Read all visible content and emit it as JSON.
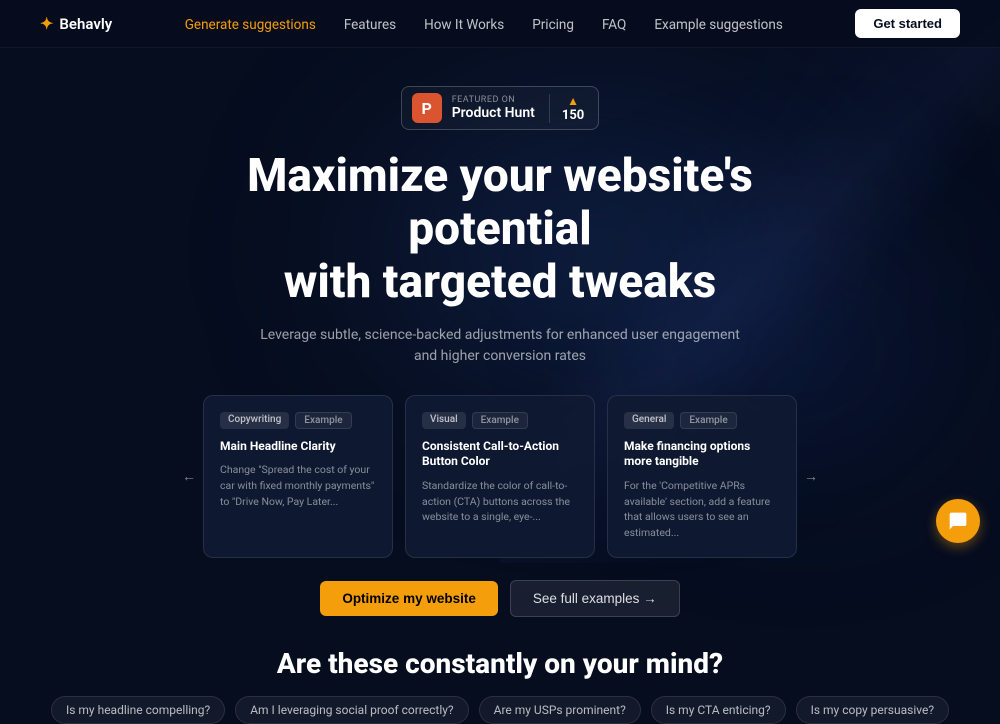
{
  "nav": {
    "logo_text": "Behavly",
    "logo_icon": "✦",
    "links": [
      {
        "label": "Generate suggestions",
        "active": true
      },
      {
        "label": "Features",
        "active": false
      },
      {
        "label": "How It Works",
        "active": false
      },
      {
        "label": "Pricing",
        "active": false
      },
      {
        "label": "FAQ",
        "active": false
      },
      {
        "label": "Example suggestions",
        "active": false
      }
    ],
    "cta_label": "Get started"
  },
  "product_hunt": {
    "featured_text": "FEATURED ON",
    "name": "Product Hunt",
    "count": "150",
    "logo_letter": "P"
  },
  "hero": {
    "title_line1": "Maximize your website's potential",
    "title_line2": "with targeted tweaks",
    "subtitle": "Leverage subtle, science-backed adjustments for enhanced user engagement and higher conversion rates"
  },
  "cards": [
    {
      "tag1": "Copywriting",
      "tag2": "Example",
      "title": "Main Headline Clarity",
      "body": "Change \"Spread the cost of your car with fixed monthly payments\" to \"Drive Now, Pay Later..."
    },
    {
      "tag1": "Visual",
      "tag2": "Example",
      "title": "Consistent Call-to-Action Button Color",
      "body": "Standardize the color of call-to-action (CTA) buttons across the website to a single, eye-..."
    },
    {
      "tag1": "General",
      "tag2": "Example",
      "title": "Make financing options more tangible",
      "body": "For the 'Competitive APRs available' section, add a feature that allows users to see an estimated..."
    }
  ],
  "buttons": {
    "primary": "Optimize my website",
    "secondary": "See full examples →"
  },
  "bottom": {
    "title": "Are these constantly on your mind?",
    "question_tags": [
      "Is my headline compelling?",
      "Am I leveraging social proof correctly?",
      "Are my USPs prominent?",
      "Is my CTA enticing?",
      "Is my copy persuasive?"
    ]
  },
  "nav_arrows": {
    "left": "←",
    "right": "→"
  }
}
